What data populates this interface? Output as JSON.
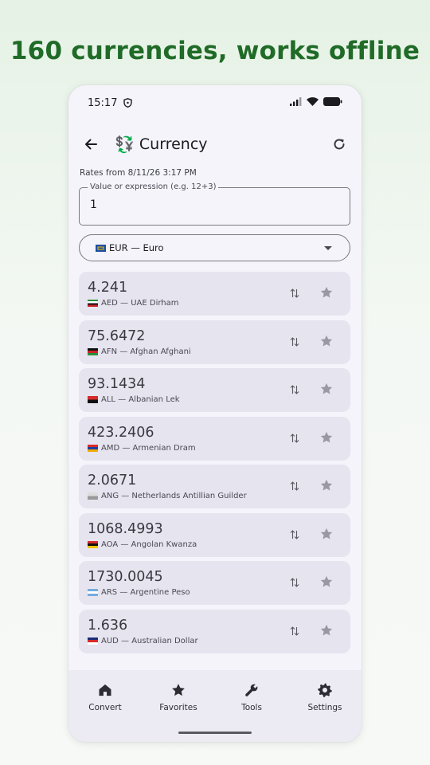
{
  "headline": "160 currencies, works offline",
  "status_bar": {
    "time": "15:17"
  },
  "app_bar": {
    "logo": "💱",
    "title": "Currency"
  },
  "rates_line": "Rates from 8/11/26 3:17 PM",
  "value_field": {
    "label": "Value or expression (e.g. 12+3)",
    "value": "1"
  },
  "base_currency": {
    "label": "EUR — Euro",
    "flag_colors": [
      "#1f4fa3",
      "#f2c200"
    ]
  },
  "rates": [
    {
      "value": "4.241",
      "label": "AED — UAE Dirham",
      "flag_colors": [
        "#2a8f3b",
        "#ffffff",
        "#111111",
        "#cc2229"
      ]
    },
    {
      "value": "75.6472",
      "label": "AFN — Afghan Afghani",
      "flag_colors": [
        "#111111",
        "#cc2229",
        "#2a8f3b"
      ]
    },
    {
      "value": "93.1434",
      "label": "ALL — Albanian Lek",
      "flag_colors": [
        "#d62b2b",
        "#111111"
      ]
    },
    {
      "value": "423.2406",
      "label": "AMD — Armenian Dram",
      "flag_colors": [
        "#d62b2b",
        "#1e3f9e",
        "#f2a900"
      ]
    },
    {
      "value": "2.0671",
      "label": "ANG — Netherlands Antillian Guilder",
      "flag_colors": [
        "#dddddd",
        "#999999"
      ]
    },
    {
      "value": "1068.4993",
      "label": "AOA — Angolan Kwanza",
      "flag_colors": [
        "#d62b2b",
        "#111111",
        "#f2c200"
      ]
    },
    {
      "value": "1730.0045",
      "label": "ARS — Argentine Peso",
      "flag_colors": [
        "#74acdf",
        "#ffffff",
        "#74acdf"
      ]
    },
    {
      "value": "1.636",
      "label": "AUD — Australian Dollar",
      "flag_colors": [
        "#1a2d7a",
        "#d62b2b",
        "#ffffff"
      ]
    }
  ],
  "nav": [
    {
      "label": "Convert",
      "icon": "home-icon"
    },
    {
      "label": "Favorites",
      "icon": "star-icon"
    },
    {
      "label": "Tools",
      "icon": "wrench-icon"
    },
    {
      "label": "Settings",
      "icon": "gear-icon"
    }
  ],
  "colors": {
    "headline": "#1f6b27",
    "card": "#e6e4ef",
    "phone_bg": "#f5f4fb",
    "nav_bg": "#ecebf4"
  }
}
